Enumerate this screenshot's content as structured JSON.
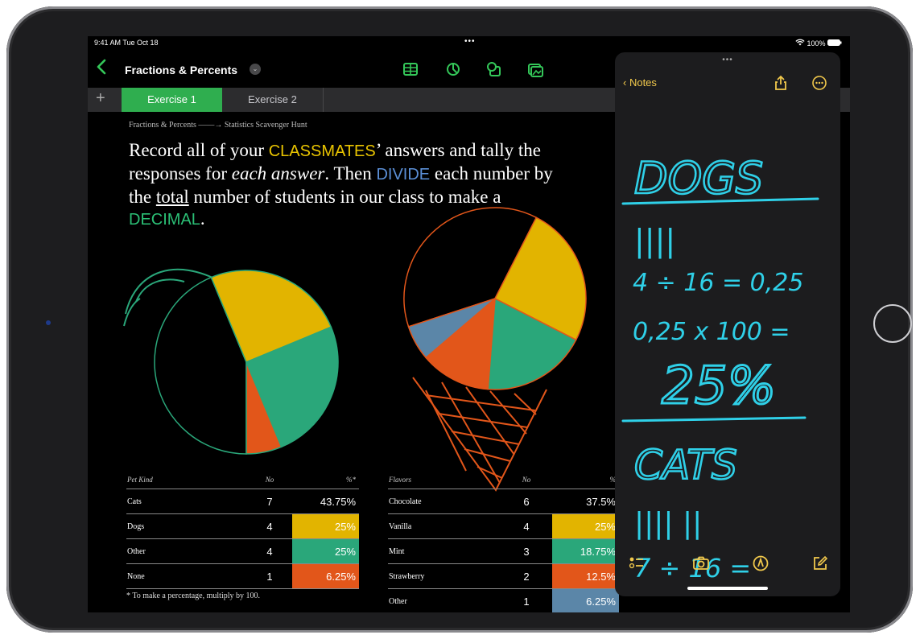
{
  "status_bar": {
    "time": "9:41 AM  Tue Oct 18",
    "dots": "•••",
    "battery": "100%"
  },
  "nav": {
    "back_icon": "chevron-left-icon",
    "title": "Fractions & Percents",
    "tools": [
      "table-icon",
      "chart-icon",
      "shape-icon",
      "media-icon"
    ]
  },
  "tabs": {
    "add": "+",
    "items": [
      "Exercise 1",
      "Exercise 2"
    ],
    "active": "Exercise 1"
  },
  "doc": {
    "breadcrumb": "Fractions & Percents ——→ Statistics Scavenger Hunt",
    "instr": {
      "p1": "Record all of your ",
      "k1": "CLASSMATES",
      "p2": "’ answers and tally the responses for ",
      "it": "each answer",
      "p3": ". Then ",
      "k2": "DIVIDE",
      "p4": " each number by the ",
      "u": "total",
      "p5": " number of students in our class to make a ",
      "k3": "DECIMAL",
      "p6": "."
    },
    "footnote": "* To make a percentage, multiply by 100."
  },
  "pets_table": {
    "headers": [
      "Pet Kind",
      "No",
      "%*"
    ],
    "rows": [
      {
        "name": "Cats",
        "no": "7",
        "pct": "43.75%",
        "color": ""
      },
      {
        "name": "Dogs",
        "no": "4",
        "pct": "25%",
        "color": "#e2b400"
      },
      {
        "name": "Other",
        "no": "4",
        "pct": "25%",
        "color": "#2aa77a"
      },
      {
        "name": "None",
        "no": "1",
        "pct": "6.25%",
        "color": "#e2561a"
      }
    ]
  },
  "flavors_table": {
    "headers": [
      "Flavors",
      "No",
      "%"
    ],
    "rows": [
      {
        "name": "Chocolate",
        "no": "6",
        "pct": "37.5%",
        "color": ""
      },
      {
        "name": "Vanilla",
        "no": "4",
        "pct": "25%",
        "color": "#e2b400"
      },
      {
        "name": "Mint",
        "no": "3",
        "pct": "18.75%",
        "color": "#2aa77a"
      },
      {
        "name": "Strawberry",
        "no": "2",
        "pct": "12.5%",
        "color": "#e2561a"
      },
      {
        "name": "Other",
        "no": "1",
        "pct": "6.25%",
        "color": "#5b86a8"
      }
    ]
  },
  "chart_data": [
    {
      "type": "pie",
      "categories": [
        "Cats",
        "Dogs",
        "Other",
        "None"
      ],
      "values": [
        43.75,
        25,
        25,
        6.25
      ],
      "colors": [
        "#000000",
        "#e2b400",
        "#2aa77a",
        "#e2561a"
      ]
    },
    {
      "type": "pie",
      "categories": [
        "Chocolate",
        "Vanilla",
        "Mint",
        "Strawberry",
        "Other"
      ],
      "values": [
        37.5,
        25,
        18.75,
        12.5,
        6.25
      ],
      "colors": [
        "#000000",
        "#e2b400",
        "#2aa77a",
        "#e2561a",
        "#5b86a8"
      ]
    }
  ],
  "notes_panel": {
    "grab": "•••",
    "back": "Notes",
    "top_icons": [
      "share-icon",
      "more-icon"
    ],
    "handwriting": [
      "DOGS",
      "||||",
      "4 ÷ 16 = 0,25",
      "0,25 x 100 =",
      "25%",
      "CATS",
      "|||| ||",
      "7 ÷ 16 ="
    ],
    "bottom_icons": [
      "checklist-icon",
      "camera-icon",
      "markup-icon",
      "compose-icon"
    ],
    "ink_color": "#2fd0e8",
    "accent": "#f2c94c"
  }
}
